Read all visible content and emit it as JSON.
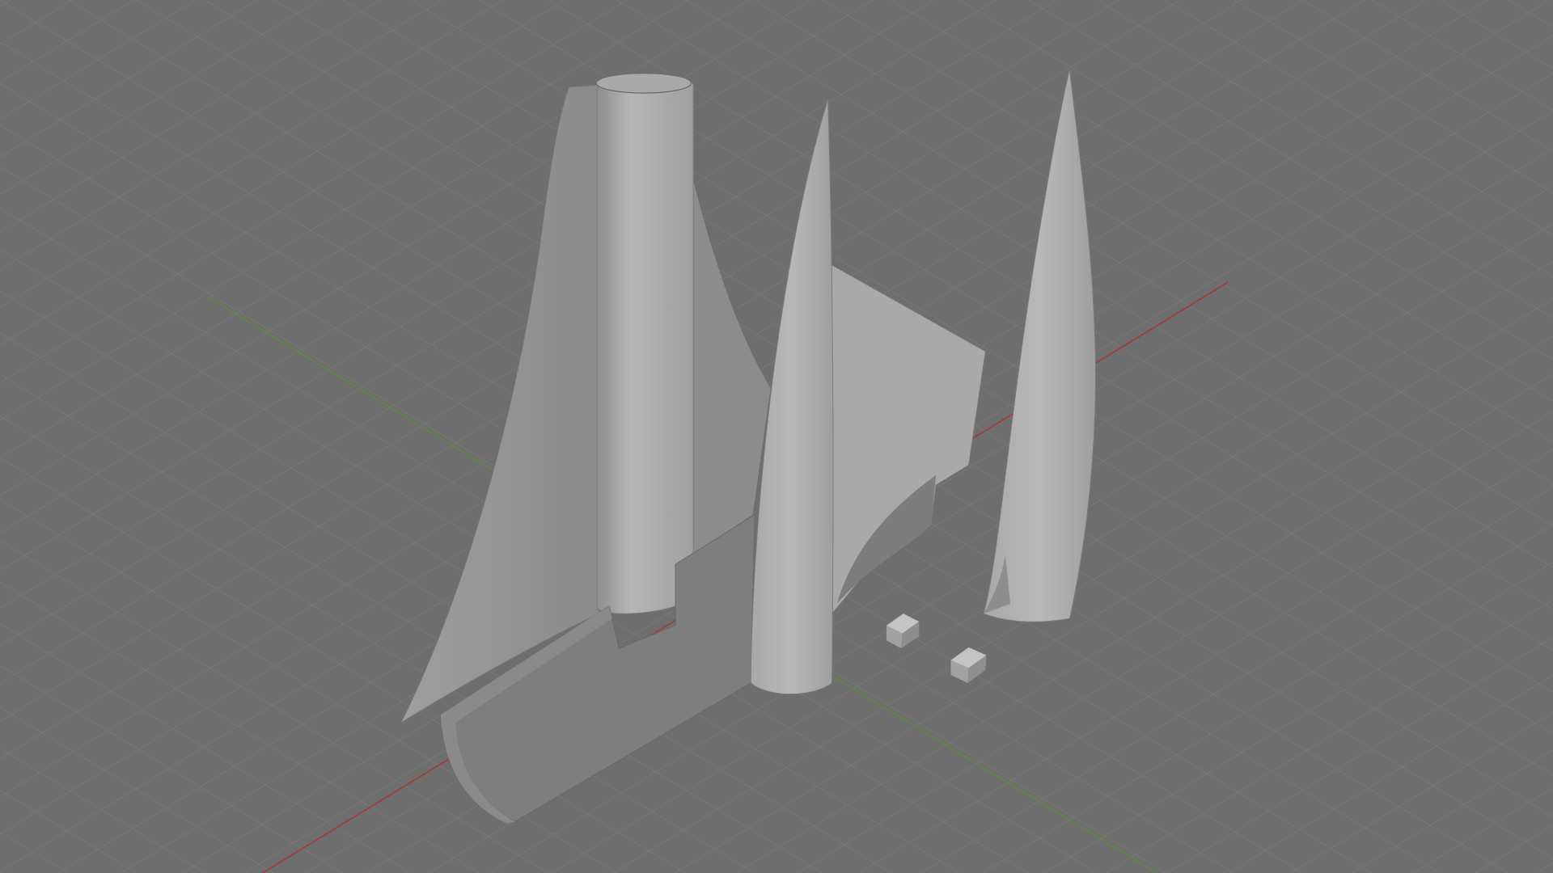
{
  "viewport": {
    "background": "#6e6e6e",
    "grid_color": "#777777",
    "x_axis_color": "#a53a3a",
    "y_axis_color": "#5d8a3a",
    "mesh_light": "#b4b4b4",
    "mesh_mid": "#9a9a9a",
    "mesh_dark": "#7c7c7c"
  },
  "objects": [
    {
      "name": "sail-fin-with-cylinder"
    },
    {
      "name": "curved-side-panel"
    },
    {
      "name": "center-cone"
    },
    {
      "name": "delta-wing"
    },
    {
      "name": "right-nose-cone"
    },
    {
      "name": "small-cube-1"
    },
    {
      "name": "small-cube-2"
    }
  ]
}
